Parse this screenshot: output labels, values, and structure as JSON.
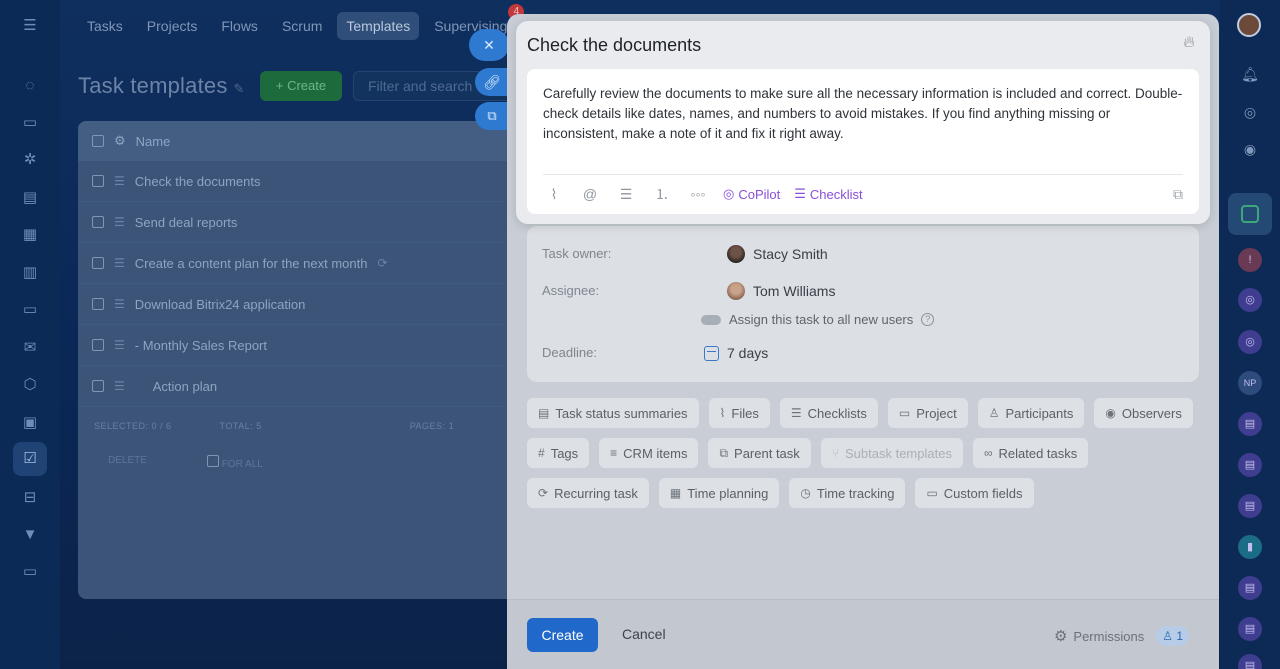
{
  "background": {
    "nav_tabs": [
      "Tasks",
      "Projects",
      "Flows",
      "Scrum",
      "Templates",
      "Supervising"
    ],
    "nav_selected": "Templates",
    "supervising_badge": "4",
    "page_title": "Task templates",
    "create_button": "+ Create",
    "filter_placeholder": "Filter and search",
    "table": {
      "header_name": "Name",
      "rows": [
        "Check the documents",
        "Send deal reports",
        "Create a content plan for the next month",
        "Download Bitrix24 application",
        "- Monthly Sales Report",
        "Action plan"
      ],
      "selected_label": "SELECTED: 0 / 6",
      "total_label": "TOTAL: 5",
      "pages_label": "PAGES: 1",
      "delete_label": "DELETE",
      "for_all_label": "FOR ALL"
    }
  },
  "side_buttons": {
    "close_icon": "close-icon",
    "link_icon": "link-icon",
    "open_icon": "external-link-icon"
  },
  "editor": {
    "title": "Check the documents",
    "description": "Carefully review the documents to make sure all the necessary information is included and correct. Double-check details like dates, names, and numbers to avoid mistakes. If you find anything missing or inconsistent, make a note of it and fix it right away.",
    "toolbar": {
      "copilot_label": "CoPilot",
      "checklist_label": "Checklist"
    }
  },
  "details": {
    "owner_label": "Task owner:",
    "owner_name": "Stacy Smith",
    "assignee_label": "Assignee:",
    "assignee_name": "Tom Williams",
    "assign_all_label": "Assign this task to all new users",
    "deadline_label": "Deadline:",
    "deadline_value": "7 days"
  },
  "chips": [
    {
      "label": "Task status summaries",
      "icon": "summary-icon",
      "enabled": true
    },
    {
      "label": "Files",
      "icon": "paperclip-icon",
      "enabled": true
    },
    {
      "label": "Checklists",
      "icon": "checklist-icon",
      "enabled": true
    },
    {
      "label": "Project",
      "icon": "folder-icon",
      "enabled": true
    },
    {
      "label": "Participants",
      "icon": "user-icon",
      "enabled": true
    },
    {
      "label": "Observers",
      "icon": "eye-icon",
      "enabled": true
    },
    {
      "label": "Tags",
      "icon": "hash-icon",
      "enabled": true
    },
    {
      "label": "CRM items",
      "icon": "crm-icon",
      "enabled": true
    },
    {
      "label": "Parent task",
      "icon": "parent-task-icon",
      "enabled": true
    },
    {
      "label": "Subtask templates",
      "icon": "subtask-icon",
      "enabled": false
    },
    {
      "label": "Related tasks",
      "icon": "link-icon",
      "enabled": true
    },
    {
      "label": "Recurring task",
      "icon": "repeat-icon",
      "enabled": true
    },
    {
      "label": "Time planning",
      "icon": "calendar-icon",
      "enabled": true
    },
    {
      "label": "Time tracking",
      "icon": "stopwatch-icon",
      "enabled": true
    },
    {
      "label": "Custom fields",
      "icon": "fields-icon",
      "enabled": true
    }
  ],
  "footer": {
    "create_label": "Create",
    "cancel_label": "Cancel",
    "permissions_label": "Permissions",
    "permissions_count": "1"
  },
  "colors": {
    "primary": "#2068c9",
    "copilot": "#8a4fd8",
    "overlay_bg": "#0a2756"
  }
}
